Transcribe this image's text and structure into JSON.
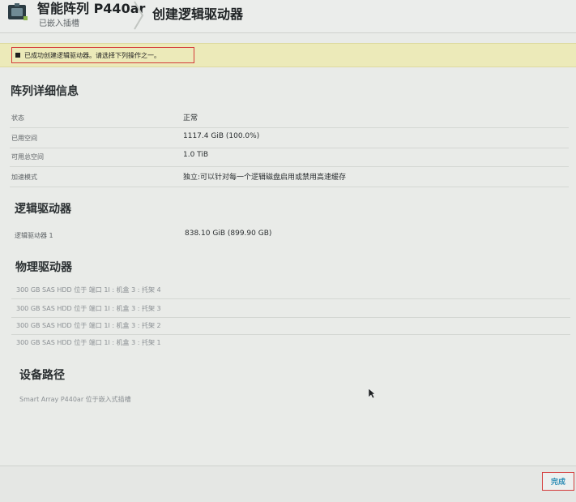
{
  "header": {
    "title": "智能阵列 P440ar",
    "subtitle": "已嵌入插槽",
    "page_title": "创建逻辑驱动器"
  },
  "banner": {
    "message": "已成功创建逻辑驱动器。请选择下列操作之一。"
  },
  "array_details": {
    "title": "阵列详细信息",
    "rows": [
      {
        "label": "状态",
        "value": "正常"
      },
      {
        "label": "已用空间",
        "value": "1117.4 GiB (100.0%)"
      },
      {
        "label": "可用总空间",
        "value": "1.0 TiB"
      },
      {
        "label": "加速模式",
        "value": "独立:可以针对每一个逻辑磁盘启用或禁用高速缓存"
      }
    ]
  },
  "logical_drives": {
    "title": "逻辑驱动器",
    "rows": [
      {
        "label": "逻辑驱动器 1",
        "value": "838.10 GiB (899.90 GB)"
      }
    ]
  },
  "physical_drives": {
    "title": "物理驱动器",
    "items": [
      "300 GB SAS HDD 位于 端口 1I : 机盒 3 : 托架 4",
      "300 GB SAS HDD 位于 端口 1I : 机盒 3 : 托架 3",
      "300 GB SAS HDD 位于 端口 1I : 机盒 3 : 托架 2",
      "300 GB SAS HDD 位于 端口 1I : 机盒 3 : 托架 1"
    ]
  },
  "device_path": {
    "title": "设备路径",
    "value": "Smart Array P440ar 位于嵌入式插槽"
  },
  "footer": {
    "finish_label": "完成"
  }
}
